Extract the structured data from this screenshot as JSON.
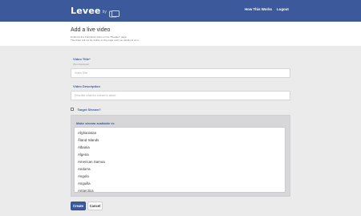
{
  "nav": {
    "brand_name": "Levee",
    "brand_by": "by",
    "links": [
      "How This Works",
      "Logout"
    ]
  },
  "page": {
    "title": "Add a live video",
    "subtitle_1": "Embed a live Facebook video on the \"Breaker\" page.",
    "subtitle_2": "The video will not be visible on the page until you decide to do it."
  },
  "form": {
    "title_label": "Video Title*",
    "title_hint": "(Not displayed)",
    "title_placeholder": "Video Title",
    "description_label": "Video Description",
    "description_placeholder": "Describe what the stream is about",
    "target_label": "Target Stream?",
    "target_checked": false,
    "availability_label": "Make stream available in:",
    "countries": [
      "Afghanistan",
      "Åland Islands",
      "Albania",
      "Algeria",
      "American Samoa",
      "Andorra",
      "Angola",
      "Anguilla",
      "Antarctica"
    ],
    "create_label": "Create",
    "cancel_label": "Cancel"
  },
  "colors": {
    "brand": "#3c5a9b",
    "background": "#ebebec",
    "panel": "#d7d7d9"
  }
}
